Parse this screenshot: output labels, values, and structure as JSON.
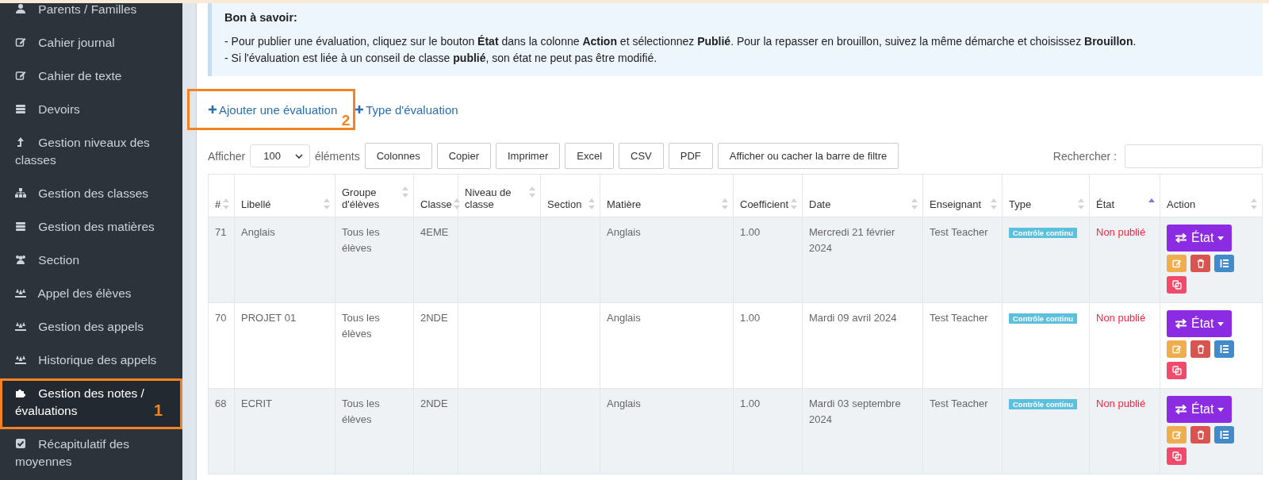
{
  "sidebar": {
    "items": [
      {
        "label": "Parents / Familles",
        "selected": false
      },
      {
        "label": "Cahier journal",
        "selected": false
      },
      {
        "label": "Cahier de texte",
        "selected": false
      },
      {
        "label": "Devoirs",
        "selected": false
      },
      {
        "label": "Gestion niveaux des classes",
        "selected": false
      },
      {
        "label": "Gestion des classes",
        "selected": false
      },
      {
        "label": "Gestion des matières",
        "selected": false
      },
      {
        "label": "Section",
        "selected": false
      },
      {
        "label": "Appel des élèves",
        "selected": false
      },
      {
        "label": "Gestion des appels",
        "selected": false
      },
      {
        "label": "Historique des appels",
        "selected": false
      },
      {
        "label": "Gestion des notes / évaluations",
        "selected": true,
        "annotation": "1"
      },
      {
        "label": "Récapitulatif des moyennes",
        "selected": false
      }
    ]
  },
  "info": {
    "title": "Bon à savoir:",
    "lines": [
      "- Pour publier une évaluation, cliquez sur le bouton **État** dans la colonne **Action** et sélectionnez **Publié**. Pour la repasser en brouillon, suivez la même démarche et choisissez **Brouillon**.",
      "- Si l'évaluation est liée à un conseil de classe **publié**, son état ne peut pas être modifié."
    ]
  },
  "actions": [
    {
      "label": "Ajouter une évaluation",
      "annotation": "2"
    },
    {
      "label": "Type d'évaluation"
    }
  ],
  "toolbar": {
    "show_label": "Afficher",
    "page_size": "100",
    "items_label": "éléments",
    "buttons": [
      "Colonnes",
      "Copier",
      "Imprimer",
      "Excel",
      "CSV",
      "PDF",
      "Afficher ou cacher la barre de filtre"
    ],
    "search_label": "Rechercher :"
  },
  "table": {
    "columns": [
      {
        "label": "#",
        "sorted": false
      },
      {
        "label": "Libellé",
        "sorted": false
      },
      {
        "label": "Groupe d'élèves",
        "sorted": false
      },
      {
        "label": "Classe",
        "sorted": false
      },
      {
        "label": "Niveau de classe",
        "sorted": false
      },
      {
        "label": "Section",
        "sorted": false
      },
      {
        "label": "Matière",
        "sorted": false
      },
      {
        "label": "Coefficient",
        "sorted": false
      },
      {
        "label": "Date",
        "sorted": false
      },
      {
        "label": "Enseignant",
        "sorted": false
      },
      {
        "label": "Type",
        "sorted": false
      },
      {
        "label": "État",
        "sorted": true
      },
      {
        "label": "Action",
        "sorted": false
      }
    ],
    "rows": [
      {
        "id": "71",
        "label": "Anglais",
        "group": "Tous les élèves",
        "class": "4EME",
        "subject": "Anglais",
        "coef": "1.00",
        "date": "Mercredi 21 février 2024",
        "teacher": "Test Teacher",
        "type": "Contrôle continu",
        "state": "Non publié",
        "state_button": "État"
      },
      {
        "id": "70",
        "label": "PROJET 01",
        "group": "Tous les élèves",
        "class": "2NDE",
        "subject": "Anglais",
        "coef": "1.00",
        "date": "Mardi 09 avril 2024",
        "teacher": "Test Teacher",
        "type": "Contrôle continu",
        "state": "Non publié",
        "state_button": "État"
      },
      {
        "id": "68",
        "label": "ECRIT",
        "group": "Tous les élèves",
        "class": "2NDE",
        "subject": "Anglais",
        "coef": "1.00",
        "date": "Mardi 03 septembre 2024",
        "teacher": "Test Teacher",
        "type": "Contrôle continu",
        "state": "Non publié",
        "state_button": "État"
      }
    ]
  }
}
